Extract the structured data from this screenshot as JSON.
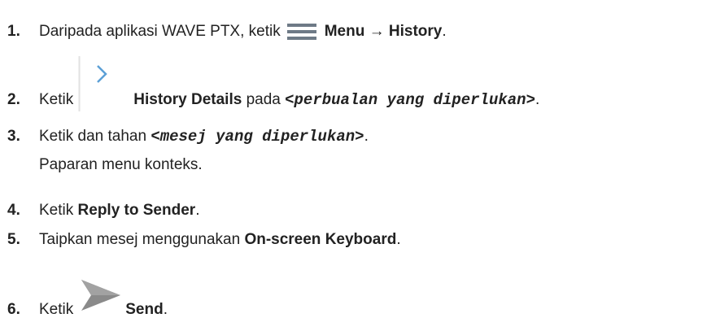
{
  "steps": [
    {
      "number": "1.",
      "parts": {
        "a": "Daripada aplikasi WAVE PTX, ketik",
        "b": "Menu",
        "c": " → ",
        "d": "History",
        "e": "."
      },
      "icon": "hamburger-menu-icon"
    },
    {
      "number": "2.",
      "parts": {
        "a": "Ketik",
        "b": "History Details",
        "c": " pada ",
        "d": "<perbualan yang diperlukan>",
        "e": "."
      },
      "icon": "chevron-right-icon"
    },
    {
      "number": "3.",
      "parts": {
        "a": "Ketik dan tahan ",
        "b": "<mesej yang diperlukan>",
        "c": "."
      },
      "result": "Paparan menu konteks."
    },
    {
      "number": "4.",
      "parts": {
        "a": "Ketik ",
        "b": "Reply to Sender",
        "c": "."
      }
    },
    {
      "number": "5.",
      "parts": {
        "a": "Taipkan mesej menggunakan ",
        "b": "On-screen Keyboard",
        "c": "."
      }
    },
    {
      "number": "6.",
      "parts": {
        "a": "Ketik",
        "b": "Send",
        "c": "."
      },
      "icon": "send-arrow-icon"
    }
  ]
}
